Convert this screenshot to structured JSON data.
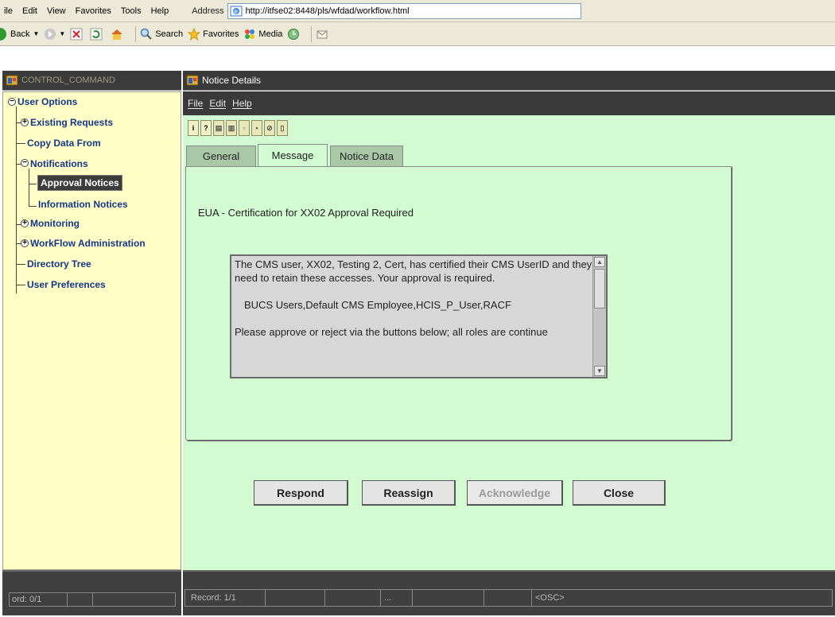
{
  "browser": {
    "menu": [
      "ile",
      "Edit",
      "View",
      "Favorites",
      "Tools",
      "Help"
    ],
    "address_label": "Address",
    "url": "http://itfse02:8448/pls/wfdad/workflow.html",
    "toolbar": {
      "back": "Back",
      "search": "Search",
      "favorites": "Favorites",
      "media": "Media"
    }
  },
  "navigator": {
    "title": "CONTROL_COMMAND",
    "tree": [
      {
        "label": "User Options"
      },
      {
        "label": "Existing Requests"
      },
      {
        "label": "Copy Data From"
      },
      {
        "label": "Notifications"
      },
      {
        "label": "Approval Notices",
        "selected": true
      },
      {
        "label": "Information Notices"
      },
      {
        "label": "Monitoring"
      },
      {
        "label": "WorkFlow Administration"
      },
      {
        "label": "Directory Tree"
      },
      {
        "label": "User Preferences"
      }
    ],
    "status_record": "ord: 0/1"
  },
  "window": {
    "title": "Notice Details",
    "menu": [
      "File",
      "Edit",
      "Help"
    ],
    "tabs": [
      {
        "label": "General",
        "active": false
      },
      {
        "label": "Message",
        "active": true
      },
      {
        "label": "Notice Data",
        "active": false
      }
    ],
    "subject": "EUA - Certification for XX02 Approval Required",
    "message": {
      "para1": "The CMS user, XX02, Testing 2, Cert, has certified their CMS UserID and they need to retain these accesses.  Your approval is required.",
      "roles": "BUCS Users,Default CMS Employee,HCIS_P_User,RACF",
      "para3": "Please approve or reject via the buttons below; all roles are continue"
    },
    "buttons": {
      "respond": "Respond",
      "reassign": "Reassign",
      "acknowledge": "Acknowledge",
      "close": "Close"
    },
    "status": {
      "record": "Record: 1/1",
      "dots": "...",
      "osc": "<OSC>"
    }
  }
}
